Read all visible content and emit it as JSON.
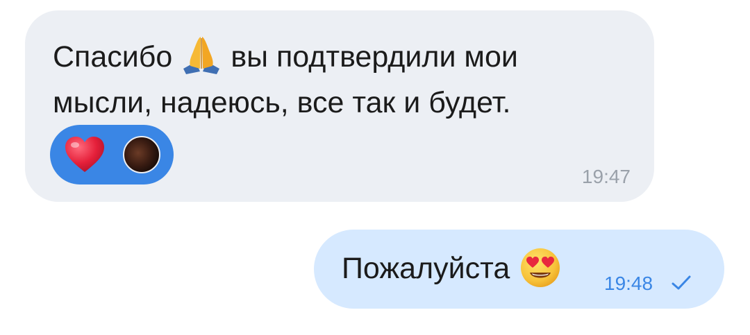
{
  "incoming": {
    "text_before_emoji": "Спасибо",
    "emoji": "folded-hands-emoji",
    "text_after_emoji": "вы подтвердили мои мысли, надеюсь, все так и будет.",
    "time": "19:47",
    "reactions": [
      "heart-emoji",
      "avatar"
    ],
    "reaction_bar_color": "#3a86e5"
  },
  "outgoing": {
    "text": "Пожалуйста",
    "emoji": "smiling-face-with-heart-eyes-emoji",
    "time": "19:48",
    "status": "sent-check-icon",
    "bubble_color": "#d6e9ff"
  },
  "colors": {
    "incoming_bubble": "#eceff4",
    "text": "#1b1b1b",
    "time_incoming": "#9aa1aa",
    "time_outgoing": "#3a86e5"
  }
}
